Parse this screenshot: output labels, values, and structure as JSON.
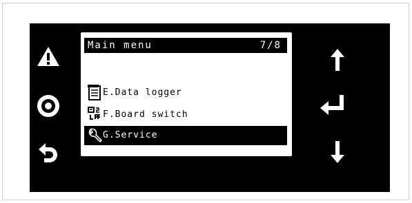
{
  "screen": {
    "title": "Main menu",
    "page_indicator": "7/8"
  },
  "menu": {
    "items": [
      {
        "label": "E.Data logger",
        "icon": "data-logger-icon",
        "selected": false
      },
      {
        "label": "F.Board switch",
        "icon": "board-switch-icon",
        "selected": false
      },
      {
        "label": "G.Service",
        "icon": "wrench-icon",
        "selected": true
      }
    ]
  },
  "buttons": {
    "left": [
      "warning-icon",
      "ok-ring-icon",
      "back-arrow-icon"
    ],
    "right": [
      "up-arrow-icon",
      "enter-icon",
      "down-arrow-icon"
    ]
  },
  "colors": {
    "panel": "#000000",
    "screen": "#ffffff",
    "highlight": "#000000",
    "highlight_text": "#ffffff"
  }
}
